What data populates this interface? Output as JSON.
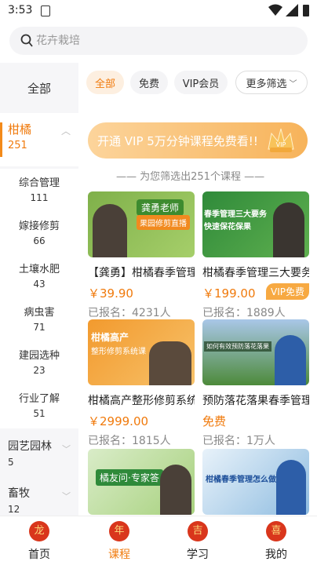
{
  "status": {
    "time": "3:53"
  },
  "search": {
    "placeholder": "花卉栽培"
  },
  "sidebar": {
    "all": "全部",
    "active": {
      "name": "柑橘",
      "count": "251"
    },
    "subitems": [
      {
        "name": "综合管理",
        "count": "111"
      },
      {
        "name": "嫁接修剪",
        "count": "66"
      },
      {
        "name": "土壤水肥",
        "count": "43"
      },
      {
        "name": "病虫害",
        "count": "71"
      },
      {
        "name": "建园选种",
        "count": "23"
      },
      {
        "name": "行业了解",
        "count": "51"
      }
    ],
    "groups": [
      {
        "name": "园艺园林",
        "count": "5"
      },
      {
        "name": "畜牧",
        "count": "12"
      }
    ]
  },
  "filters": {
    "all": "全部",
    "free": "免费",
    "vip": "VIP会员",
    "more": "更多筛选"
  },
  "banner": {
    "text": "开通 VIP 5万分钟课程免费看!!",
    "badge": "VIP"
  },
  "section": {
    "text": "—— 为您筛选出251个课程 ——"
  },
  "cards": [
    {
      "title": "【龚勇】柑橘春季管理",
      "price": "￥39.90",
      "enrolled": "已报名：4231人",
      "thumb_line1": "龚勇老师",
      "thumb_line2": "果园修剪直播"
    },
    {
      "title": "柑橘春季管理三大要务",
      "price": "￥199.00",
      "enrolled": "已报名：1889人",
      "vip": "VIP免费",
      "thumb_line1": "春季管理三大要务",
      "thumb_line2": "快速保花保果"
    },
    {
      "title": "柑橘高产整形修剪系统课",
      "price": "￥2999.00",
      "enrolled": "已报名：1815人",
      "thumb_line1": "柑橘高产",
      "thumb_line2": "整形修剪系统课"
    },
    {
      "title": "预防落花落果春季管理",
      "price": "免费",
      "enrolled": "已报名：1万人",
      "thumb_line1": "如何有效预防落花落果"
    },
    {
      "title": "",
      "thumb_line1": "橘友问·专家答"
    },
    {
      "title": "",
      "thumb_line1": "柑橘春季管理怎么做?"
    }
  ],
  "tabs": [
    {
      "label": "首页",
      "icon": "龙"
    },
    {
      "label": "课程",
      "icon": "年"
    },
    {
      "label": "学习",
      "icon": "吉"
    },
    {
      "label": "我的",
      "icon": "喜"
    }
  ],
  "colors": {
    "accent": "#f07a0c",
    "tab_icon": "#d9361c"
  }
}
